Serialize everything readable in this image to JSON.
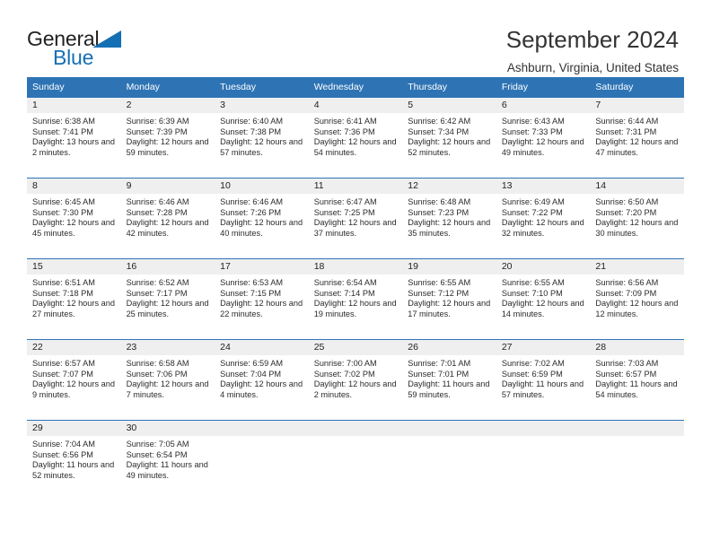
{
  "brand": {
    "name_part1": "General",
    "name_part2": "Blue",
    "triangle_color": "#156FB5"
  },
  "header": {
    "title": "September 2024",
    "location": "Ashburn, Virginia, United States"
  },
  "calendar": {
    "header_bg": "#2E74B5",
    "daynum_bg": "#EFEFEF",
    "weekday_headers": [
      "Sunday",
      "Monday",
      "Tuesday",
      "Wednesday",
      "Thursday",
      "Friday",
      "Saturday"
    ],
    "weeks": [
      [
        {
          "day": "1",
          "sunrise": "Sunrise: 6:38 AM",
          "sunset": "Sunset: 7:41 PM",
          "daylight": "Daylight: 13 hours and 2 minutes."
        },
        {
          "day": "2",
          "sunrise": "Sunrise: 6:39 AM",
          "sunset": "Sunset: 7:39 PM",
          "daylight": "Daylight: 12 hours and 59 minutes."
        },
        {
          "day": "3",
          "sunrise": "Sunrise: 6:40 AM",
          "sunset": "Sunset: 7:38 PM",
          "daylight": "Daylight: 12 hours and 57 minutes."
        },
        {
          "day": "4",
          "sunrise": "Sunrise: 6:41 AM",
          "sunset": "Sunset: 7:36 PM",
          "daylight": "Daylight: 12 hours and 54 minutes."
        },
        {
          "day": "5",
          "sunrise": "Sunrise: 6:42 AM",
          "sunset": "Sunset: 7:34 PM",
          "daylight": "Daylight: 12 hours and 52 minutes."
        },
        {
          "day": "6",
          "sunrise": "Sunrise: 6:43 AM",
          "sunset": "Sunset: 7:33 PM",
          "daylight": "Daylight: 12 hours and 49 minutes."
        },
        {
          "day": "7",
          "sunrise": "Sunrise: 6:44 AM",
          "sunset": "Sunset: 7:31 PM",
          "daylight": "Daylight: 12 hours and 47 minutes."
        }
      ],
      [
        {
          "day": "8",
          "sunrise": "Sunrise: 6:45 AM",
          "sunset": "Sunset: 7:30 PM",
          "daylight": "Daylight: 12 hours and 45 minutes."
        },
        {
          "day": "9",
          "sunrise": "Sunrise: 6:46 AM",
          "sunset": "Sunset: 7:28 PM",
          "daylight": "Daylight: 12 hours and 42 minutes."
        },
        {
          "day": "10",
          "sunrise": "Sunrise: 6:46 AM",
          "sunset": "Sunset: 7:26 PM",
          "daylight": "Daylight: 12 hours and 40 minutes."
        },
        {
          "day": "11",
          "sunrise": "Sunrise: 6:47 AM",
          "sunset": "Sunset: 7:25 PM",
          "daylight": "Daylight: 12 hours and 37 minutes."
        },
        {
          "day": "12",
          "sunrise": "Sunrise: 6:48 AM",
          "sunset": "Sunset: 7:23 PM",
          "daylight": "Daylight: 12 hours and 35 minutes."
        },
        {
          "day": "13",
          "sunrise": "Sunrise: 6:49 AM",
          "sunset": "Sunset: 7:22 PM",
          "daylight": "Daylight: 12 hours and 32 minutes."
        },
        {
          "day": "14",
          "sunrise": "Sunrise: 6:50 AM",
          "sunset": "Sunset: 7:20 PM",
          "daylight": "Daylight: 12 hours and 30 minutes."
        }
      ],
      [
        {
          "day": "15",
          "sunrise": "Sunrise: 6:51 AM",
          "sunset": "Sunset: 7:18 PM",
          "daylight": "Daylight: 12 hours and 27 minutes."
        },
        {
          "day": "16",
          "sunrise": "Sunrise: 6:52 AM",
          "sunset": "Sunset: 7:17 PM",
          "daylight": "Daylight: 12 hours and 25 minutes."
        },
        {
          "day": "17",
          "sunrise": "Sunrise: 6:53 AM",
          "sunset": "Sunset: 7:15 PM",
          "daylight": "Daylight: 12 hours and 22 minutes."
        },
        {
          "day": "18",
          "sunrise": "Sunrise: 6:54 AM",
          "sunset": "Sunset: 7:14 PM",
          "daylight": "Daylight: 12 hours and 19 minutes."
        },
        {
          "day": "19",
          "sunrise": "Sunrise: 6:55 AM",
          "sunset": "Sunset: 7:12 PM",
          "daylight": "Daylight: 12 hours and 17 minutes."
        },
        {
          "day": "20",
          "sunrise": "Sunrise: 6:55 AM",
          "sunset": "Sunset: 7:10 PM",
          "daylight": "Daylight: 12 hours and 14 minutes."
        },
        {
          "day": "21",
          "sunrise": "Sunrise: 6:56 AM",
          "sunset": "Sunset: 7:09 PM",
          "daylight": "Daylight: 12 hours and 12 minutes."
        }
      ],
      [
        {
          "day": "22",
          "sunrise": "Sunrise: 6:57 AM",
          "sunset": "Sunset: 7:07 PM",
          "daylight": "Daylight: 12 hours and 9 minutes."
        },
        {
          "day": "23",
          "sunrise": "Sunrise: 6:58 AM",
          "sunset": "Sunset: 7:06 PM",
          "daylight": "Daylight: 12 hours and 7 minutes."
        },
        {
          "day": "24",
          "sunrise": "Sunrise: 6:59 AM",
          "sunset": "Sunset: 7:04 PM",
          "daylight": "Daylight: 12 hours and 4 minutes."
        },
        {
          "day": "25",
          "sunrise": "Sunrise: 7:00 AM",
          "sunset": "Sunset: 7:02 PM",
          "daylight": "Daylight: 12 hours and 2 minutes."
        },
        {
          "day": "26",
          "sunrise": "Sunrise: 7:01 AM",
          "sunset": "Sunset: 7:01 PM",
          "daylight": "Daylight: 11 hours and 59 minutes."
        },
        {
          "day": "27",
          "sunrise": "Sunrise: 7:02 AM",
          "sunset": "Sunset: 6:59 PM",
          "daylight": "Daylight: 11 hours and 57 minutes."
        },
        {
          "day": "28",
          "sunrise": "Sunrise: 7:03 AM",
          "sunset": "Sunset: 6:57 PM",
          "daylight": "Daylight: 11 hours and 54 minutes."
        }
      ],
      [
        {
          "day": "29",
          "sunrise": "Sunrise: 7:04 AM",
          "sunset": "Sunset: 6:56 PM",
          "daylight": "Daylight: 11 hours and 52 minutes."
        },
        {
          "day": "30",
          "sunrise": "Sunrise: 7:05 AM",
          "sunset": "Sunset: 6:54 PM",
          "daylight": "Daylight: 11 hours and 49 minutes."
        },
        {
          "day": "",
          "sunrise": "",
          "sunset": "",
          "daylight": ""
        },
        {
          "day": "",
          "sunrise": "",
          "sunset": "",
          "daylight": ""
        },
        {
          "day": "",
          "sunrise": "",
          "sunset": "",
          "daylight": ""
        },
        {
          "day": "",
          "sunrise": "",
          "sunset": "",
          "daylight": ""
        },
        {
          "day": "",
          "sunrise": "",
          "sunset": "",
          "daylight": ""
        }
      ]
    ]
  }
}
